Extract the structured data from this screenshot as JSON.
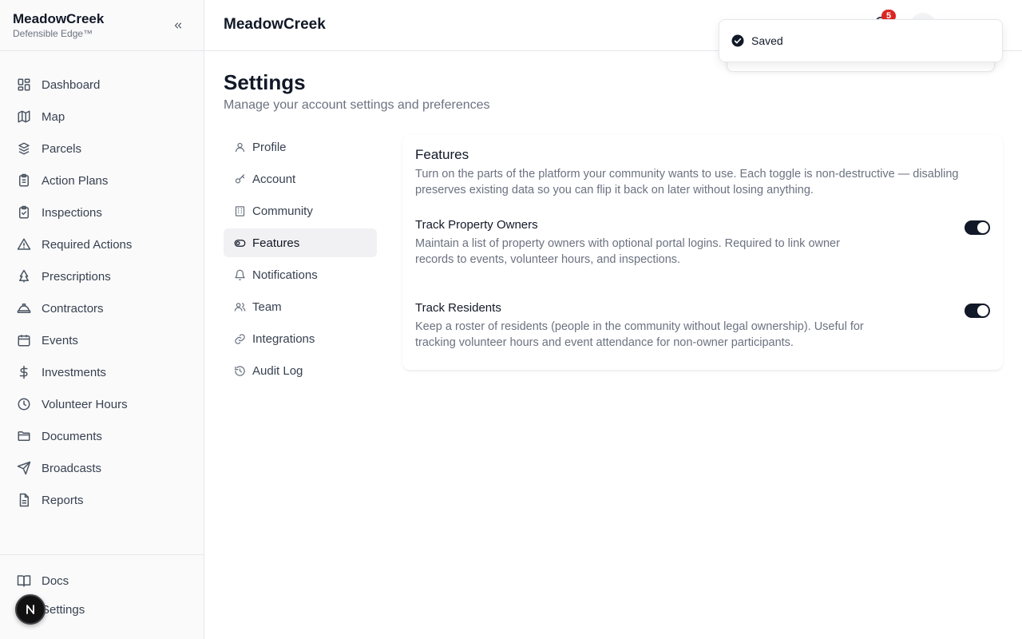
{
  "brand": {
    "name": "MeadowCreek",
    "subtitle": "Defensible Edge™"
  },
  "sidebar": {
    "items": [
      {
        "label": "Dashboard",
        "icon": "dashboard-icon"
      },
      {
        "label": "Map",
        "icon": "map-icon"
      },
      {
        "label": "Parcels",
        "icon": "parcels-icon"
      },
      {
        "label": "Action Plans",
        "icon": "clipboard-icon"
      },
      {
        "label": "Inspections",
        "icon": "clipboard-check-icon"
      },
      {
        "label": "Required Actions",
        "icon": "alert-triangle-icon"
      },
      {
        "label": "Prescriptions",
        "icon": "tree-icon"
      },
      {
        "label": "Contractors",
        "icon": "hard-hat-icon"
      },
      {
        "label": "Events",
        "icon": "calendar-icon"
      },
      {
        "label": "Investments",
        "icon": "dollar-icon"
      },
      {
        "label": "Volunteer Hours",
        "icon": "clock-icon"
      },
      {
        "label": "Documents",
        "icon": "folder-icon"
      },
      {
        "label": "Broadcasts",
        "icon": "send-icon"
      },
      {
        "label": "Reports",
        "icon": "file-text-icon"
      }
    ],
    "footer": [
      {
        "label": "Docs",
        "icon": "book-icon"
      },
      {
        "label": "Settings",
        "icon": "settings-icon"
      }
    ],
    "fab_letter": "N"
  },
  "topbar": {
    "title": "MeadowCreek",
    "notification_count": "5"
  },
  "toast": {
    "text": "Saved"
  },
  "page": {
    "title": "Settings",
    "subtitle": "Manage your account settings and preferences"
  },
  "settings_nav": [
    {
      "label": "Profile",
      "icon": "user-icon",
      "active": false
    },
    {
      "label": "Account",
      "icon": "key-icon",
      "active": false
    },
    {
      "label": "Community",
      "icon": "building-icon",
      "active": false
    },
    {
      "label": "Features",
      "icon": "toggle-icon",
      "active": true
    },
    {
      "label": "Notifications",
      "icon": "bell-icon",
      "active": false
    },
    {
      "label": "Team",
      "icon": "users-icon",
      "active": false
    },
    {
      "label": "Integrations",
      "icon": "link-icon",
      "active": false
    },
    {
      "label": "Audit Log",
      "icon": "history-icon",
      "active": false
    }
  ],
  "features_card": {
    "title": "Features",
    "description": "Turn on the parts of the platform your community wants to use. Each toggle is non-destructive — disabling preserves existing data so you can flip it back on later without losing anything.",
    "items": [
      {
        "title": "Track Property Owners",
        "description": "Maintain a list of property owners with optional portal logins. Required to link owner records to events, volunteer hours, and inspections.",
        "enabled": true
      },
      {
        "title": "Track Residents",
        "description": "Keep a roster of residents (people in the community without legal ownership). Useful for tracking volunteer hours and event attendance for non-owner participants.",
        "enabled": true
      }
    ]
  },
  "colors": {
    "accent": "#111827",
    "badge": "#dc2626",
    "muted_text": "#6b7280"
  }
}
